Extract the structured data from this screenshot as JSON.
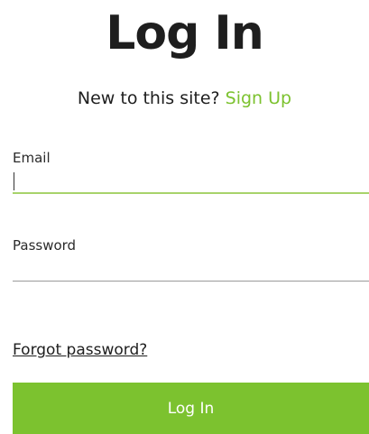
{
  "header": {
    "title": "Log In"
  },
  "signup": {
    "prompt": "New to this site?",
    "link_label": "Sign Up"
  },
  "form": {
    "email": {
      "label": "Email",
      "value": "",
      "placeholder": ""
    },
    "password": {
      "label": "Password",
      "value": "",
      "placeholder": ""
    },
    "forgot_label": "Forgot password?",
    "submit_label": "Log In"
  },
  "colors": {
    "accent": "#7cc22f",
    "focus_underline": "#a8d36b",
    "text": "#1e1e1e"
  }
}
